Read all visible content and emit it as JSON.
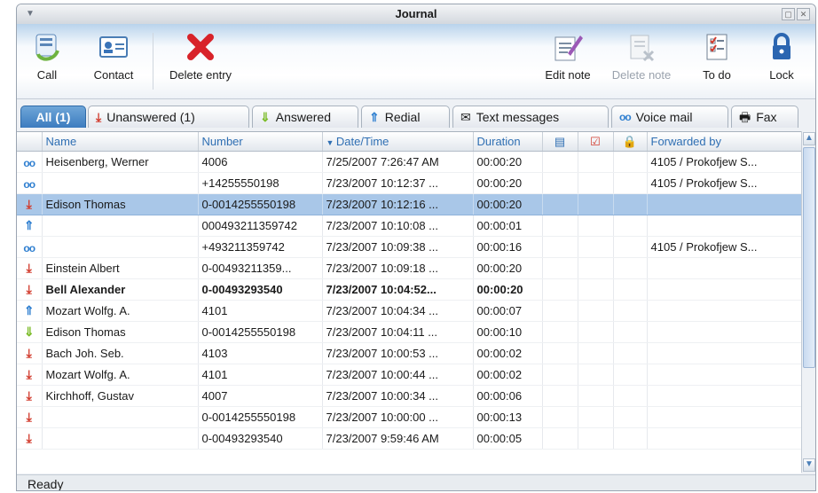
{
  "window": {
    "title": "Journal"
  },
  "toolbar": {
    "call": "Call",
    "contact": "Contact",
    "delete_entry": "Delete entry",
    "edit_note": "Edit note",
    "delete_note": "Delete note",
    "to_do": "To do",
    "lock": "Lock"
  },
  "tabs": {
    "all": "All (1)",
    "unanswered": "Unanswered (1)",
    "answered": "Answered",
    "redial": "Redial",
    "text_messages": "Text messages",
    "voice_mail": "Voice mail",
    "fax": "Fax"
  },
  "columns": {
    "name": "Name",
    "number": "Number",
    "datetime": "Date/Time",
    "duration": "Duration",
    "forwarded_by": "Forwarded by"
  },
  "rows": [
    {
      "type": "voicemail",
      "name": "Heisenberg, Werner",
      "number": "4006",
      "datetime": "7/25/2007 7:26:47 AM",
      "duration": "00:00:20",
      "forwarded_by": "4105 / Prokofjew S..."
    },
    {
      "type": "voicemail",
      "name": "",
      "number": "+14255550198",
      "datetime": "7/23/2007  10:12:37 ...",
      "duration": "00:00:20",
      "forwarded_by": "4105 / Prokofjew S..."
    },
    {
      "type": "unanswered",
      "name": "Edison Thomas",
      "number": "0-0014255550198",
      "datetime": "7/23/2007  10:12:16 ...",
      "duration": "00:00:20",
      "forwarded_by": ""
    },
    {
      "type": "redial",
      "name": "",
      "number": "000493211359742",
      "datetime": "7/23/2007  10:10:08 ...",
      "duration": "00:00:01",
      "forwarded_by": ""
    },
    {
      "type": "voicemail",
      "name": "",
      "number": "+493211359742",
      "datetime": "7/23/2007  10:09:38 ...",
      "duration": "00:00:16",
      "forwarded_by": "4105 / Prokofjew S..."
    },
    {
      "type": "unanswered",
      "name": "Einstein Albert",
      "number": "0-00493211359...",
      "datetime": "7/23/2007  10:09:18 ...",
      "duration": "00:00:20",
      "forwarded_by": ""
    },
    {
      "type": "unanswered",
      "name": "Bell Alexander",
      "number": "0-00493293540",
      "datetime": "7/23/2007  10:04:52...",
      "duration": "00:00:20",
      "forwarded_by": ""
    },
    {
      "type": "redial",
      "name": "Mozart Wolfg. A.",
      "number": "4101",
      "datetime": "7/23/2007  10:04:34 ...",
      "duration": "00:00:07",
      "forwarded_by": ""
    },
    {
      "type": "answered",
      "name": "Edison Thomas",
      "number": "0-0014255550198",
      "datetime": "7/23/2007  10:04:11 ...",
      "duration": "00:00:10",
      "forwarded_by": ""
    },
    {
      "type": "unanswered",
      "name": "Bach Joh. Seb.",
      "number": "4103",
      "datetime": "7/23/2007  10:00:53 ...",
      "duration": "00:00:02",
      "forwarded_by": ""
    },
    {
      "type": "unanswered",
      "name": "Mozart Wolfg. A.",
      "number": "4101",
      "datetime": "7/23/2007  10:00:44 ...",
      "duration": "00:00:02",
      "forwarded_by": ""
    },
    {
      "type": "unanswered",
      "name": "Kirchhoff, Gustav",
      "number": "4007",
      "datetime": "7/23/2007  10:00:34 ...",
      "duration": "00:00:06",
      "forwarded_by": ""
    },
    {
      "type": "unanswered",
      "name": "",
      "number": "0-0014255550198",
      "datetime": "7/23/2007  10:00:00 ...",
      "duration": "00:00:13",
      "forwarded_by": ""
    },
    {
      "type": "unanswered",
      "name": "",
      "number": "0-00493293540",
      "datetime": "7/23/2007 9:59:46 AM",
      "duration": "00:00:05",
      "forwarded_by": ""
    }
  ],
  "selected_row": 2,
  "bold_row": 6,
  "status": {
    "text": "Ready"
  }
}
